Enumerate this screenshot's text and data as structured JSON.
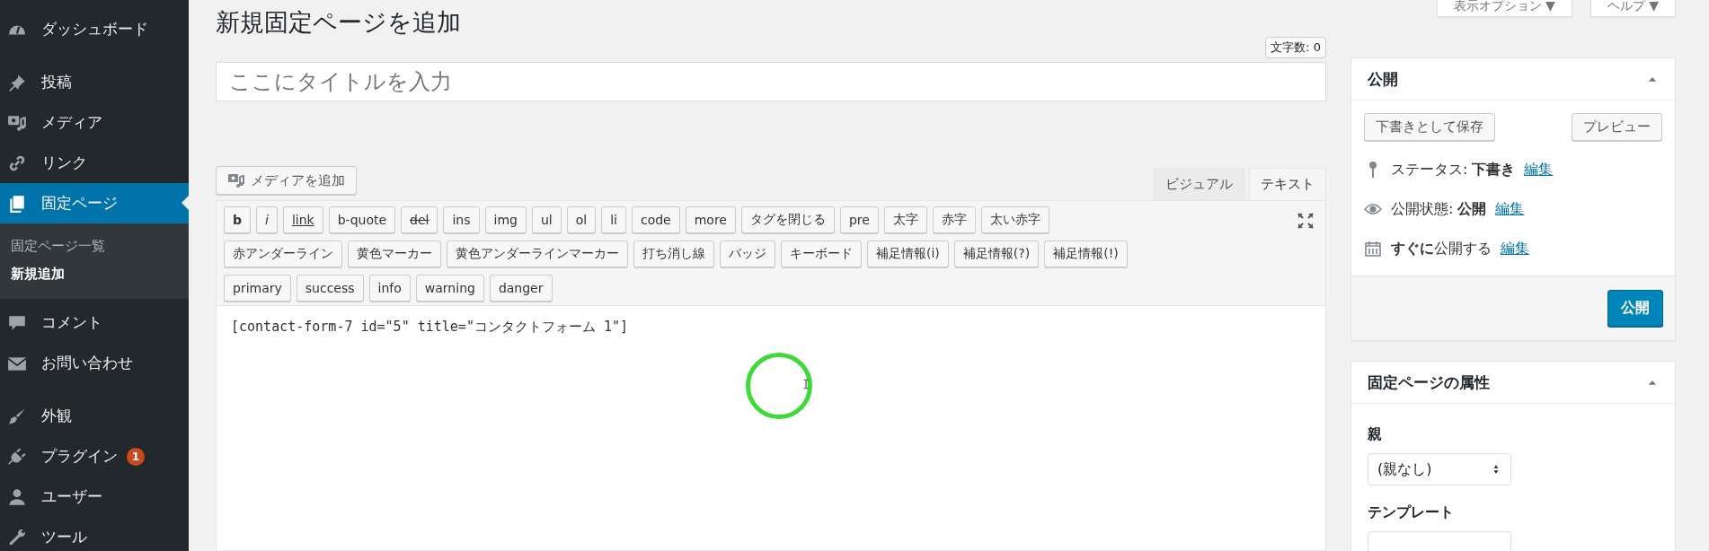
{
  "sidebar": {
    "groups": [
      [
        {
          "label": "ダッシュボード",
          "selected": false
        }
      ],
      [
        {
          "label": "投稿",
          "selected": false
        },
        {
          "label": "メディア",
          "selected": false
        },
        {
          "label": "リンク",
          "selected": false
        },
        {
          "label": "固定ページ",
          "selected": true,
          "children": [
            {
              "label": "固定ページ一覧",
              "selected": false
            },
            {
              "label": "新規追加",
              "selected": true
            }
          ]
        },
        {
          "label": "コメント",
          "selected": false
        },
        {
          "label": "お問い合わせ",
          "selected": false
        }
      ],
      [
        {
          "label": "外観",
          "selected": false
        },
        {
          "label": "プラグイン",
          "selected": false,
          "badge": "1"
        },
        {
          "label": "ユーザー",
          "selected": false
        },
        {
          "label": "ツール",
          "selected": false
        }
      ]
    ]
  },
  "screen_tabs": [
    "表示オプション ▼",
    "ヘルプ ▼"
  ],
  "page_title": "新規固定ページを追加",
  "word_count": "文字数: 0",
  "title_field": {
    "placeholder": "ここにタイトルを入力"
  },
  "add_media_button": "メディアを追加",
  "editor_tabs": [
    {
      "label": "ビジュアル",
      "selected": false
    },
    {
      "label": "テキスト",
      "selected": true
    }
  ],
  "toolbar_rows": [
    [
      {
        "label": "b",
        "kind": "bold"
      },
      {
        "label": "i",
        "kind": "italic"
      },
      {
        "label": "link",
        "kind": "underline"
      },
      {
        "label": "b-quote",
        "kind": "plain"
      },
      {
        "label": "del",
        "kind": "strike"
      },
      {
        "label": "ins",
        "kind": "plain"
      },
      {
        "label": "img",
        "kind": "plain"
      },
      {
        "label": "ul",
        "kind": "plain"
      },
      {
        "label": "ol",
        "kind": "plain"
      },
      {
        "label": "li",
        "kind": "plain"
      },
      {
        "label": "code",
        "kind": "plain"
      },
      {
        "label": "more",
        "kind": "plain"
      },
      {
        "label": "タグを閉じる",
        "kind": "plain"
      },
      {
        "label": "pre",
        "kind": "plain"
      },
      {
        "label": "太字",
        "kind": "plain"
      },
      {
        "label": "赤字",
        "kind": "plain"
      },
      {
        "label": "太い赤字",
        "kind": "plain"
      }
    ],
    [
      {
        "label": "赤アンダーライン",
        "kind": "plain"
      },
      {
        "label": "黄色マーカー",
        "kind": "plain"
      },
      {
        "label": "黄色アンダーラインマーカー",
        "kind": "plain"
      },
      {
        "label": "打ち消し線",
        "kind": "plain"
      },
      {
        "label": "バッジ",
        "kind": "plain"
      },
      {
        "label": "キーボード",
        "kind": "plain"
      },
      {
        "label": "補足情報(i)",
        "kind": "plain"
      },
      {
        "label": "補足情報(?)",
        "kind": "plain"
      },
      {
        "label": "補足情報(!)",
        "kind": "plain"
      }
    ],
    [
      {
        "label": "primary",
        "kind": "plain"
      },
      {
        "label": "success",
        "kind": "plain"
      },
      {
        "label": "info",
        "kind": "plain"
      },
      {
        "label": "warning",
        "kind": "plain"
      },
      {
        "label": "danger",
        "kind": "plain"
      }
    ]
  ],
  "editor_content": "[contact-form-7 id=\"5\" title=\"コンタクトフォーム 1\"]",
  "publish_box": {
    "title": "公開",
    "save_draft_button": "下書きとして保存",
    "preview_button": "プレビュー",
    "rows": [
      {
        "text": "ステータス: **下書き**",
        "link": "編集"
      },
      {
        "text": "公開状態: **公開**",
        "link": "編集"
      },
      {
        "text": "**すぐに**公開する",
        "link": "編集"
      }
    ],
    "publish_button": "公開"
  },
  "attributes_box": {
    "title": "固定ページの属性",
    "fields": [
      {
        "label": "親",
        "value": "(親なし)"
      },
      {
        "label": "テンプレート"
      }
    ]
  }
}
